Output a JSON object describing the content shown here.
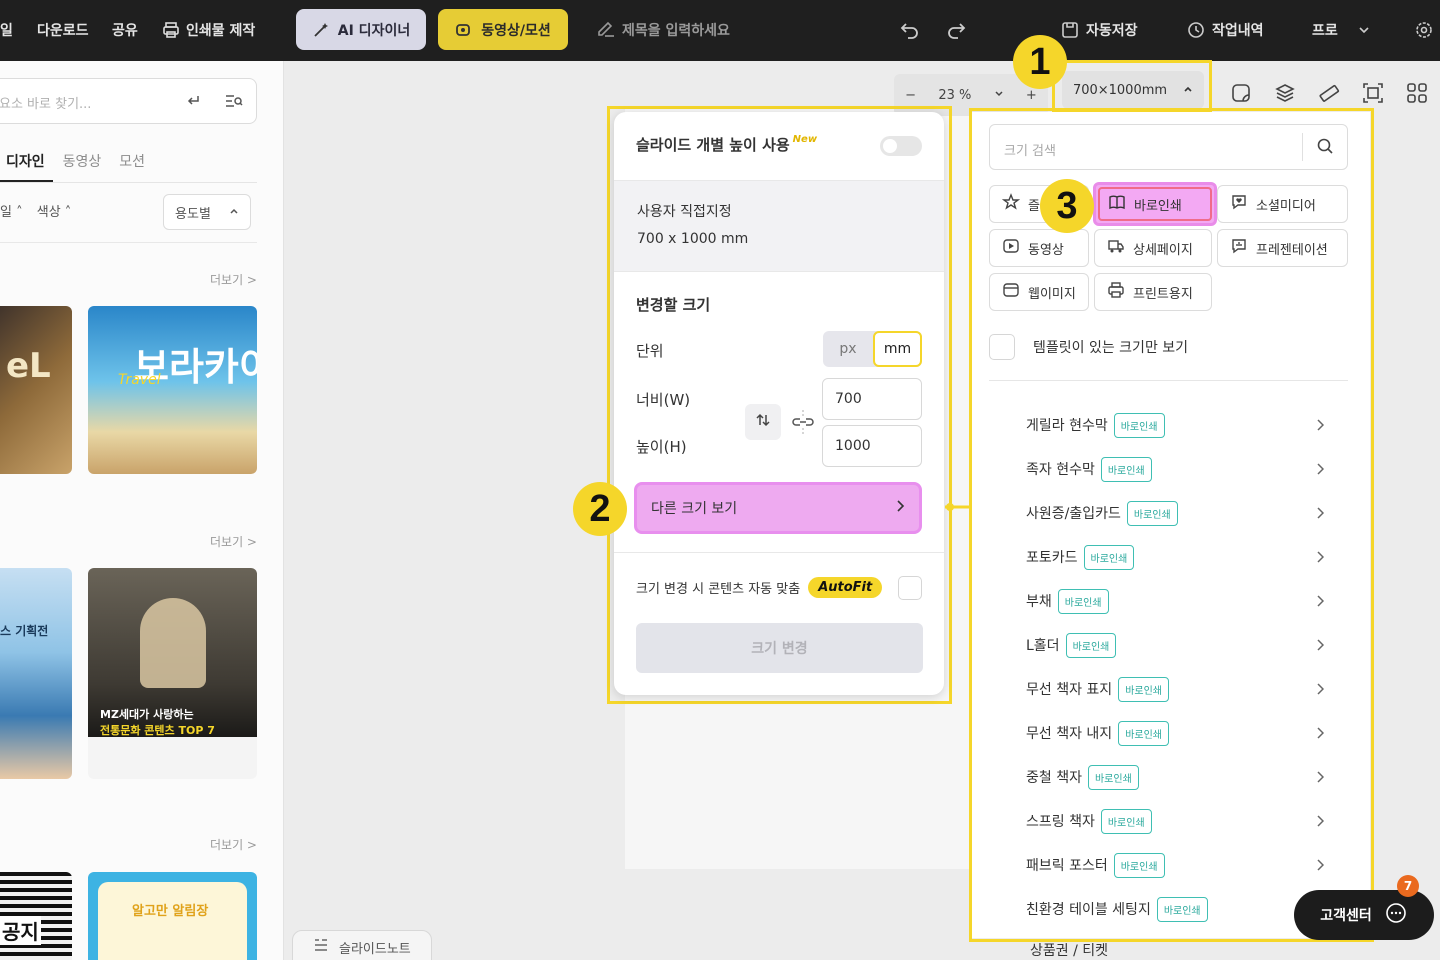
{
  "topbar": {
    "cut_item": "일",
    "download": "다운로드",
    "share": "공유",
    "print_make": "인쇄물 제작",
    "ai_designer": "AI 디자이너",
    "video_motion": "동영상/모션",
    "title_placeholder": "제목을 입력하세요",
    "autosave": "자동저장",
    "history": "작업내역",
    "pro": "프로"
  },
  "left_panel": {
    "search_placeholder": "요소 바로 찾기...",
    "tabs": [
      {
        "label": "디자인",
        "active": true
      },
      {
        "label": "동영상",
        "active": false
      },
      {
        "label": "모션",
        "active": false
      }
    ],
    "filters": [
      "일 ˄",
      "색상 ˄"
    ],
    "purpose_dropdown": "용도별",
    "more_label": "더보기 >",
    "thumbs": {
      "travel_big": "보라카이",
      "travel_script": "Travel",
      "mz_line1": "MZ세대가 사랑하는",
      "mz_line2": "전통문화 콘텐츠 TOP 7",
      "plan": "스 기획전",
      "notice": "공지",
      "notice2": "알고만 알림장"
    }
  },
  "canvas": {
    "zoom": "23 %",
    "size_button": "700×1000mm",
    "step_numbers": [
      "1",
      "2",
      "3"
    ]
  },
  "size_panel": {
    "slide_height_label": "슬라이드 개별 높이 사용",
    "new_tag": "New",
    "custom_title": "사용자 직접지정",
    "custom_size": "700 x 1000 mm",
    "change_size_label": "변경할 크기",
    "unit_label": "단위",
    "unit_px": "px",
    "unit_mm": "mm",
    "width_label": "너비(W)",
    "height_label": "높이(H)",
    "width_value": "700",
    "height_value": "1000",
    "other_sizes": "다른 크기 보기",
    "autofit_label": "크기 변경 시 콘텐츠 자동 맞춤",
    "autofit_tag": "AutoFit",
    "resize_button": "크기 변경"
  },
  "category_panel": {
    "search_placeholder": "크기 검색",
    "chips": {
      "favorites": "즐",
      "print": "바로인쇄",
      "social": "소셜미디어",
      "video": "동영상",
      "detail": "상세페이지",
      "presentation": "프레젠테이션",
      "web": "웹이미지",
      "print_paper": "프린트용지"
    },
    "template_only": "템플릿이 있는 크기만 보기",
    "tag": "바로인쇄",
    "items": [
      "게릴라 현수막",
      "족자 현수막",
      "사원증/출입카드",
      "포토카드",
      "부채",
      "L홀더",
      "무선 책자 표지",
      "무선 책자 내지",
      "중철 책자",
      "스프링 책자",
      "패브릭 포스터",
      "친환경 테이블 세팅지"
    ],
    "peek_item": "상품권 / 티켓"
  },
  "help": {
    "label": "고객센터",
    "count": "7"
  },
  "slide_note": "슬라이드노트",
  "colors": {
    "accent_yellow": "#f5d62a",
    "pink": "#eeaaf0",
    "teal": "#3fbfb3"
  }
}
